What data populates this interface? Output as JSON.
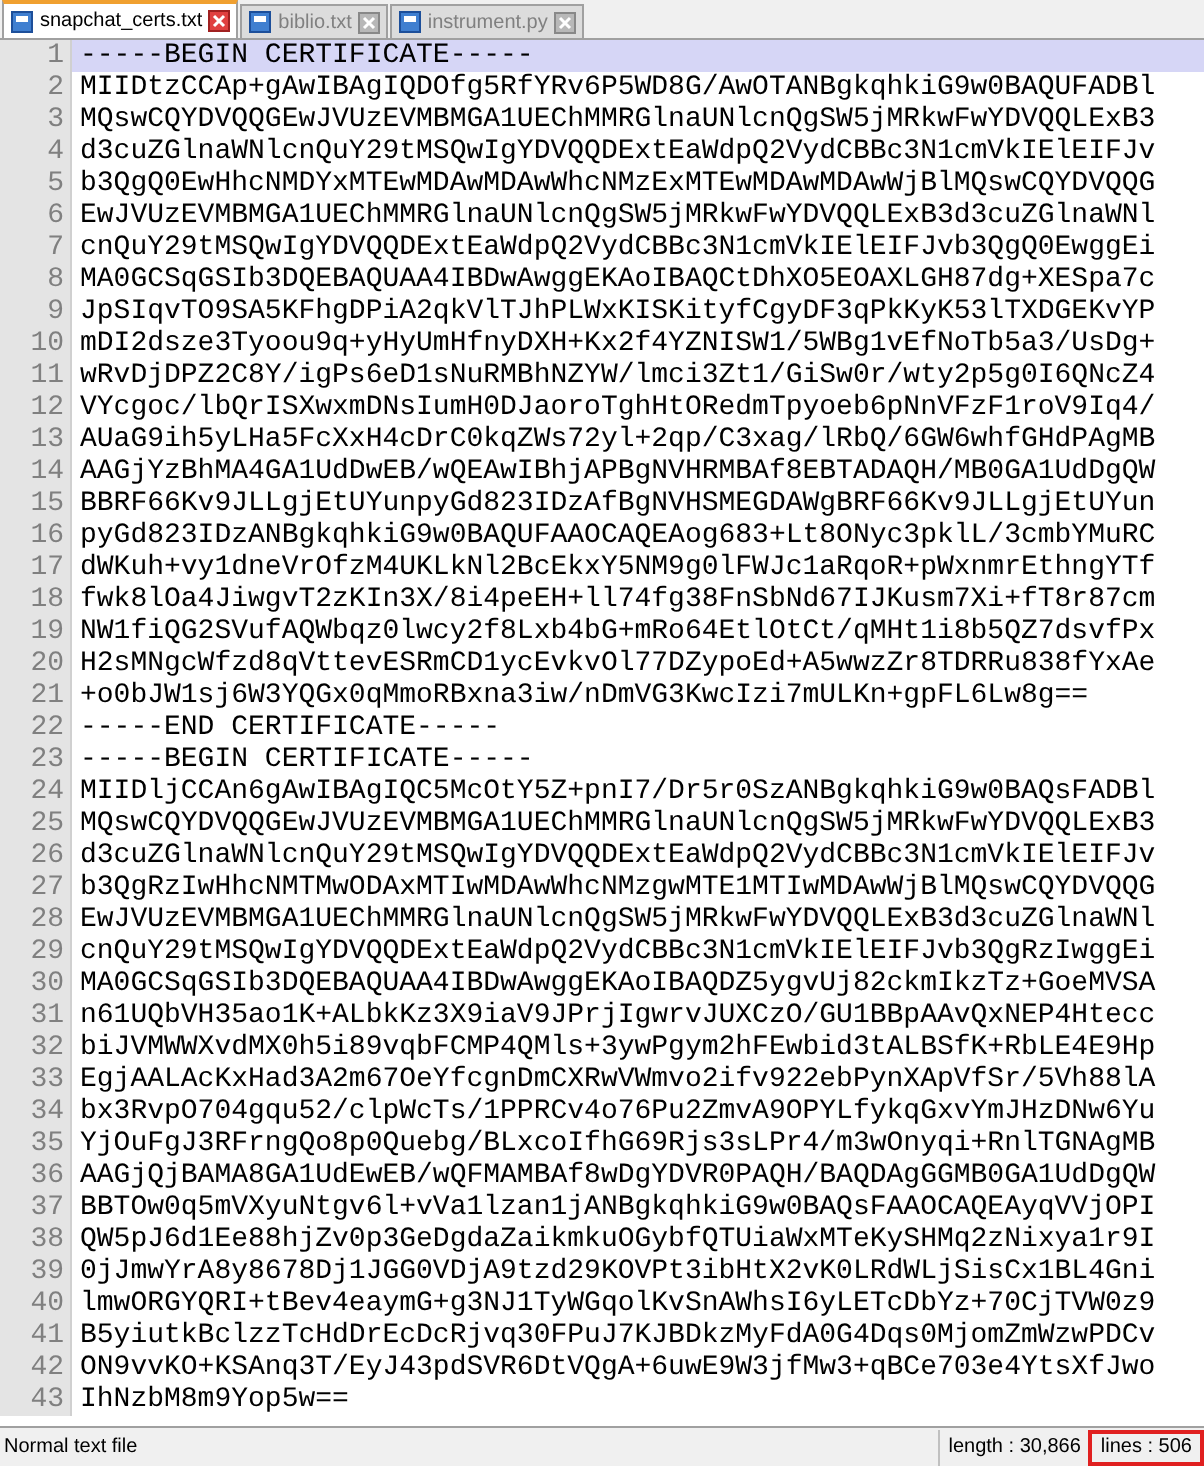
{
  "tabs": [
    {
      "label": "snapchat_certs.txt",
      "selected": true
    },
    {
      "label": "biblio.txt",
      "selected": false
    },
    {
      "label": "instrument.py",
      "selected": false
    }
  ],
  "lines": [
    {
      "number": "1",
      "text": "-----BEGIN CERTIFICATE-----",
      "current": true
    },
    {
      "number": "2",
      "text": "MIIDtzCCAp+gAwIBAgIQDOfg5RfYRv6P5WD8G/AwOTANBgkqhkiG9w0BAQUFADBl",
      "current": false
    },
    {
      "number": "3",
      "text": "MQswCQYDVQQGEwJVUzEVMBMGA1UEChMMRGlnaUNlcnQgSW5jMRkwFwYDVQQLExB3",
      "current": false
    },
    {
      "number": "4",
      "text": "d3cuZGlnaWNlcnQuY29tMSQwIgYDVQQDExtEaWdpQ2VydCBBc3N1cmVkIElEIFJv",
      "current": false
    },
    {
      "number": "5",
      "text": "b3QgQ0EwHhcNMDYxMTEwMDAwMDAwWhcNMzExMTEwMDAwMDAwWjBlMQswCQYDVQQG",
      "current": false
    },
    {
      "number": "6",
      "text": "EwJVUzEVMBMGA1UEChMMRGlnaUNlcnQgSW5jMRkwFwYDVQQLExB3d3cuZGlnaWNl",
      "current": false
    },
    {
      "number": "7",
      "text": "cnQuY29tMSQwIgYDVQQDExtEaWdpQ2VydCBBc3N1cmVkIElEIFJvb3QgQ0EwggEi",
      "current": false
    },
    {
      "number": "8",
      "text": "MA0GCSqGSIb3DQEBAQUAA4IBDwAwggEKAoIBAQCtDhXO5EOAXLGH87dg+XESpa7c",
      "current": false
    },
    {
      "number": "9",
      "text": "JpSIqvTO9SA5KFhgDPiA2qkVlTJhPLWxKISKityfCgyDF3qPkKyK53lTXDGEKvYP",
      "current": false
    },
    {
      "number": "10",
      "text": "mDI2dsze3Tyoou9q+yHyUmHfnyDXH+Kx2f4YZNISW1/5WBg1vEfNoTb5a3/UsDg+",
      "current": false
    },
    {
      "number": "11",
      "text": "wRvDjDPZ2C8Y/igPs6eD1sNuRMBhNZYW/lmci3Zt1/GiSw0r/wty2p5g0I6QNcZ4",
      "current": false
    },
    {
      "number": "12",
      "text": "VYcgoc/lbQrISXwxmDNsIumH0DJaoroTghHtORedmTpyoeb6pNnVFzF1roV9Iq4/",
      "current": false
    },
    {
      "number": "13",
      "text": "AUaG9ih5yLHa5FcXxH4cDrC0kqZWs72yl+2qp/C3xag/lRbQ/6GW6whfGHdPAgMB",
      "current": false
    },
    {
      "number": "14",
      "text": "AAGjYzBhMA4GA1UdDwEB/wQEAwIBhjAPBgNVHRMBAf8EBTADAQH/MB0GA1UdDgQW",
      "current": false
    },
    {
      "number": "15",
      "text": "BBRF66Kv9JLLgjEtUYunpyGd823IDzAfBgNVHSMEGDAWgBRF66Kv9JLLgjEtUYun",
      "current": false
    },
    {
      "number": "16",
      "text": "pyGd823IDzANBgkqhkiG9w0BAQUFAAOCAQEAog683+Lt8ONyc3pklL/3cmbYMuRC",
      "current": false
    },
    {
      "number": "17",
      "text": "dWKuh+vy1dneVrOfzM4UKLkNl2BcEkxY5NM9g0lFWJc1aRqoR+pWxnmrEthngYTf",
      "current": false
    },
    {
      "number": "18",
      "text": "fwk8lOa4JiwgvT2zKIn3X/8i4peEH+ll74fg38FnSbNd67IJKusm7Xi+fT8r87cm",
      "current": false
    },
    {
      "number": "19",
      "text": "NW1fiQG2SVufAQWbqz0lwcy2f8Lxb4bG+mRo64EtlOtCt/qMHt1i8b5QZ7dsvfPx",
      "current": false
    },
    {
      "number": "20",
      "text": "H2sMNgcWfzd8qVttevESRmCD1ycEvkvOl77DZypoEd+A5wwzZr8TDRRu838fYxAe",
      "current": false
    },
    {
      "number": "21",
      "text": "+o0bJW1sj6W3YQGx0qMmoRBxna3iw/nDmVG3KwcIzi7mULKn+gpFL6Lw8g==",
      "current": false
    },
    {
      "number": "22",
      "text": "-----END CERTIFICATE-----",
      "current": false
    },
    {
      "number": "23",
      "text": "-----BEGIN CERTIFICATE-----",
      "current": false
    },
    {
      "number": "24",
      "text": "MIIDljCCAn6gAwIBAgIQC5McOtY5Z+pnI7/Dr5r0SzANBgkqhkiG9w0BAQsFADBl",
      "current": false
    },
    {
      "number": "25",
      "text": "MQswCQYDVQQGEwJVUzEVMBMGA1UEChMMRGlnaUNlcnQgSW5jMRkwFwYDVQQLExB3",
      "current": false
    },
    {
      "number": "26",
      "text": "d3cuZGlnaWNlcnQuY29tMSQwIgYDVQQDExtEaWdpQ2VydCBBc3N1cmVkIElEIFJv",
      "current": false
    },
    {
      "number": "27",
      "text": "b3QgRzIwHhcNMTMwODAxMTIwMDAwWhcNMzgwMTE1MTIwMDAwWjBlMQswCQYDVQQG",
      "current": false
    },
    {
      "number": "28",
      "text": "EwJVUzEVMBMGA1UEChMMRGlnaUNlcnQgSW5jMRkwFwYDVQQLExB3d3cuZGlnaWNl",
      "current": false
    },
    {
      "number": "29",
      "text": "cnQuY29tMSQwIgYDVQQDExtEaWdpQ2VydCBBc3N1cmVkIElEIFJvb3QgRzIwggEi",
      "current": false
    },
    {
      "number": "30",
      "text": "MA0GCSqGSIb3DQEBAQUAA4IBDwAwggEKAoIBAQDZ5ygvUj82ckmIkzTz+GoeMVSA",
      "current": false
    },
    {
      "number": "31",
      "text": "n61UQbVH35ao1K+ALbkKz3X9iaV9JPrjIgwrvJUXCzO/GU1BBpAAvQxNEP4Htecc",
      "current": false
    },
    {
      "number": "32",
      "text": "biJVMWWXvdMX0h5i89vqbFCMP4QMls+3ywPgym2hFEwbid3tALBSfK+RbLE4E9Hp",
      "current": false
    },
    {
      "number": "33",
      "text": "EgjAALAcKxHad3A2m67OeYfcgnDmCXRwVWmvo2ifv922ebPynXApVfSr/5Vh88lA",
      "current": false
    },
    {
      "number": "34",
      "text": "bx3RvpO704gqu52/clpWcTs/1PPRCv4o76Pu2ZmvA9OPYLfykqGxvYmJHzDNw6Yu",
      "current": false
    },
    {
      "number": "35",
      "text": "YjOuFgJ3RFrngQo8p0Quebg/BLxcoIfhG69Rjs3sLPr4/m3wOnyqi+RnlTGNAgMB",
      "current": false
    },
    {
      "number": "36",
      "text": "AAGjQjBAMA8GA1UdEwEB/wQFMAMBAf8wDgYDVR0PAQH/BAQDAgGGMB0GA1UdDgQW",
      "current": false
    },
    {
      "number": "37",
      "text": "BBTOw0q5mVXyuNtgv6l+vVa1lzan1jANBgkqhkiG9w0BAQsFAAOCAQEAyqVVjOPI",
      "current": false
    },
    {
      "number": "38",
      "text": "QW5pJ6d1Ee88hjZv0p3GeDgdaZaikmkuOGybfQTUiaWxMTeKySHMq2zNixya1r9I",
      "current": false
    },
    {
      "number": "39",
      "text": "0jJmwYrA8y8678Dj1JGG0VDjA9tzd29KOVPt3ibHtX2vK0LRdWLjSisCx1BL4Gni",
      "current": false
    },
    {
      "number": "40",
      "text": "lmwORGYQRI+tBev4eaymG+g3NJ1TyWGqolKvSnAWhsI6yLETcDbYz+70CjTVW0z9",
      "current": false
    },
    {
      "number": "41",
      "text": "B5yiutkBclzzTcHdDrEcDcRjvq30FPuJ7KJBDkzMyFdA0G4Dqs0MjomZmWzwPDCv",
      "current": false
    },
    {
      "number": "42",
      "text": "ON9vvKO+KSAnq3T/EyJ43pdSVR6DtVQgA+6uwE9W3jfMw3+qBCe703e4YtsXfJwo",
      "current": false
    },
    {
      "number": "43",
      "text": "IhNzbM8m9Yop5w==",
      "current": false
    }
  ],
  "status_bar": {
    "file_type": "Normal text file",
    "items": [
      {
        "text": "length : 30,866",
        "highlighted": false
      },
      {
        "text": "lines : 506",
        "highlighted": true
      }
    ]
  }
}
